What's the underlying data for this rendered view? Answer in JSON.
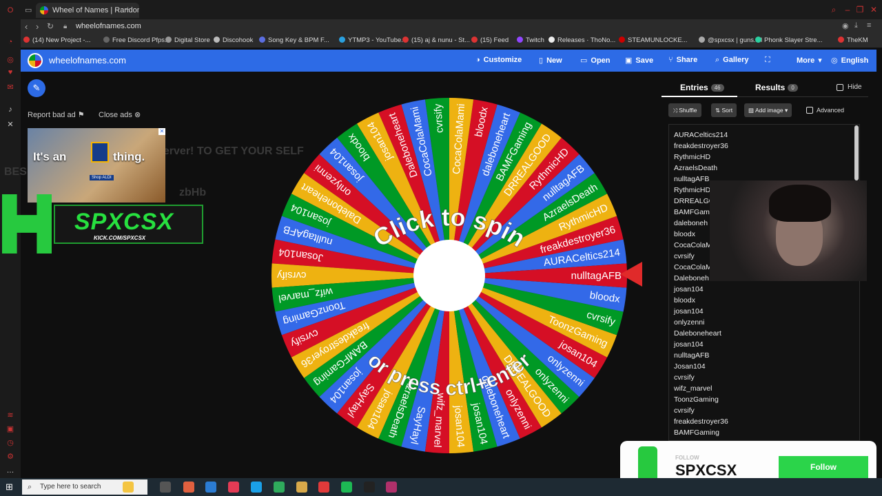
{
  "browser": {
    "tab_title": "Wheel of Names | Random",
    "url": "wheelofnames.com",
    "bookmarks": [
      "(14) New Project -...",
      "Free Discord Pfps...",
      "Digital Store",
      "Discohook",
      "Song Key & BPM F...",
      "YTMP3 - YouTube...",
      "(15) aj & nunu - St...",
      "(15) Feed",
      "Twitch",
      "Releases · ThoNo...",
      "STEAMUNLOCKE...",
      "@spxcsx | guns.lol",
      "Phonk Slayer Stre...",
      "TheKM"
    ],
    "bookmark_colors": [
      "#d33",
      "#666",
      "#999",
      "#bbb",
      "#5b6ee1",
      "#2aa0e0",
      "#d33",
      "#d33",
      "#9146ff",
      "#eee",
      "#c00",
      "#aaa",
      "#2ad0a0",
      "#d33"
    ]
  },
  "site": {
    "title": "wheelofnames.com",
    "header_buttons": [
      {
        "label": "Customize",
        "icon": "palette-icon",
        "glyph": "◑"
      },
      {
        "label": "New",
        "icon": "file-icon",
        "glyph": "▯"
      },
      {
        "label": "Open",
        "icon": "folder-icon",
        "glyph": "▭"
      },
      {
        "label": "Save",
        "icon": "save-icon",
        "glyph": "▣"
      },
      {
        "label": "Share",
        "icon": "share-icon",
        "glyph": "⑂"
      },
      {
        "label": "Gallery",
        "icon": "search-icon",
        "glyph": "⌕"
      },
      {
        "label": "",
        "icon": "fullscreen-icon",
        "glyph": "⛶"
      },
      {
        "label": "More",
        "icon": "chevron-down-icon",
        "glyph": "▾"
      },
      {
        "label": "English",
        "icon": "globe-icon",
        "glyph": "◎"
      }
    ]
  },
  "ads": {
    "report": "Report bad ad",
    "close": "Close ads",
    "ad_text_a": "It's an",
    "ad_text_b": "thing.",
    "ad_shop": "Shop ALDI",
    "ghost_line1": "server! TO GET YOUR SELF",
    "ghost_line2": "BES      CK WE SHOW LOVE HE",
    "ghost_line3": "zbHb"
  },
  "brand": {
    "name": "SPXCSX",
    "url": "KICK.COM/SPXCSX"
  },
  "wheel": {
    "center_line1": "Click to spin",
    "center_line2": "or press ctrl+enter",
    "colors": [
      "#3369e8",
      "#d50f25",
      "#eeb211",
      "#009925"
    ],
    "slices": [
      "AURACeltics214",
      "freakdestroyer36",
      "RythmicHD",
      "AzraelsDeath",
      "nulltagAFB",
      "RythmicHD",
      "DRREALGOOD",
      "BAMFGaming",
      "daleboneheart",
      "bloodx",
      "CocaColaMami",
      "cvrsify",
      "CocaColaMami",
      "Daleboneheart",
      "josan104",
      "bloodx",
      "josan104",
      "onlyzenni",
      "Daleboneheart",
      "josan104",
      "nulltagAFB",
      "Josan104",
      "cvrsify",
      "wifz_marvel",
      "ToonzGaming",
      "cvrsify",
      "freakdestroyer36",
      "BAMFGaming",
      "josan104",
      "SayHayl",
      "josan104",
      "AzraelsDeath",
      "SayHayl",
      "wifz_marvel",
      "josan104",
      "josan104",
      "daleboneheart",
      "onlyzenni",
      "DRREALGOOD",
      "onlyzenni",
      "onlyzenni",
      "josan104",
      "ToonzGaming",
      "cvrsify",
      "bloodx",
      "nulltagAFB"
    ]
  },
  "panel": {
    "tab_entries": "Entries",
    "entries_count": "46",
    "tab_results": "Results",
    "results_count": "0",
    "hide_label": "Hide",
    "shuffle_label": "Shuffle",
    "sort_label": "Sort",
    "add_image_label": "Add image",
    "advanced_label": "Advanced",
    "entries": [
      "AURACeltics214",
      "freakdestroyer36",
      "RythmicHD",
      "AzraelsDeath",
      "nulltagAFB",
      "RythmicHD",
      "DRREALGO",
      "BAMFGami",
      "daleboneh",
      "bloodx",
      "CocaColaM",
      "cvrsify",
      "CocaColaM",
      "Daleboneh",
      "josan104",
      "bloodx",
      "josan104",
      "onlyzenni",
      "Daleboneheart",
      "josan104",
      "nulltagAFB",
      "Josan104",
      "cvrsify",
      "wifz_marvel",
      "ToonzGaming",
      "cvrsify",
      "freakdestroyer36",
      "BAMFGaming"
    ]
  },
  "follow": {
    "small": "FOLLOW",
    "name": "SPXCSX",
    "button": "Follow"
  },
  "taskbar": {
    "search_placeholder": "Type here to search",
    "app_colors": [
      "#e0603f",
      "#2b7cd3",
      "#e33b55",
      "#1aa0e8",
      "#2faa5c",
      "#d8a94a",
      "#e13a3a",
      "#1db954",
      "#222",
      "#b0306a"
    ]
  }
}
